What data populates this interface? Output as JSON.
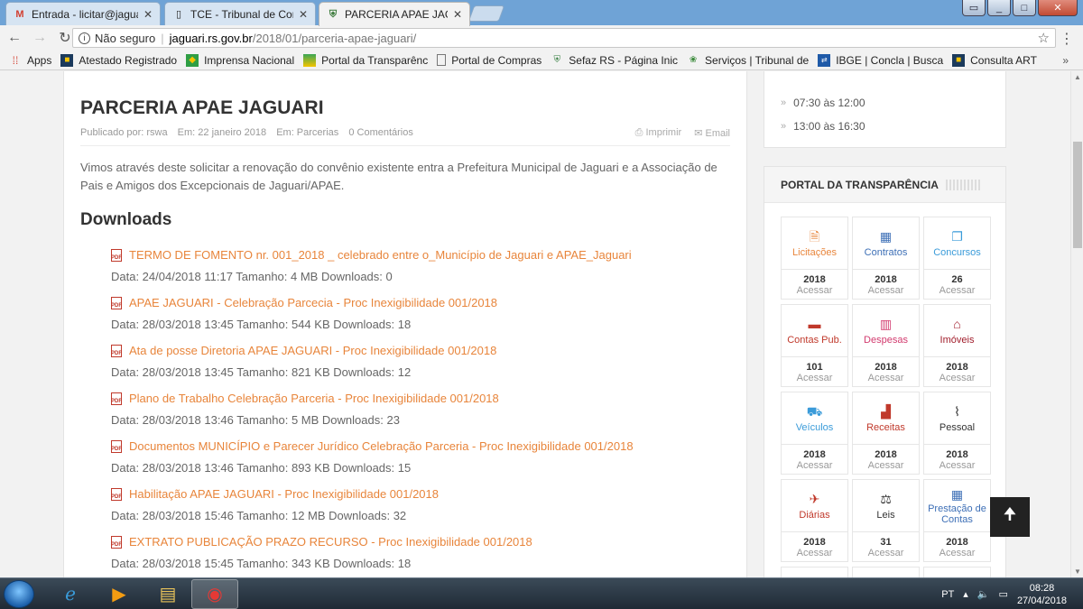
{
  "browser": {
    "tabs": [
      {
        "title": "Entrada - licitar@jaguari",
        "favicon": "gmail-icon",
        "active": false
      },
      {
        "title": "TCE - Tribunal de Contas",
        "favicon": "document-icon",
        "active": false
      },
      {
        "title": "PARCERIA APAE JAGUARI",
        "favicon": "jaguari-crest-icon",
        "active": true
      }
    ],
    "url_security": "Não seguro",
    "url_host": "jaguari.rs.gov.br",
    "url_path": "/2018/01/parceria-apae-jaguari/",
    "bookmarks": [
      {
        "label": "Apps",
        "icon": "apps-grid-icon"
      },
      {
        "label": "Atestado Registrado",
        "icon": "crea-icon"
      },
      {
        "label": "Imprensa Nacional",
        "icon": "brazil-flag-icon"
      },
      {
        "label": "Portal da Transparênc",
        "icon": "transparency-icon"
      },
      {
        "label": "Portal de Compras",
        "icon": "page-icon"
      },
      {
        "label": "Sefaz RS - Página Inic",
        "icon": "rs-crest-icon"
      },
      {
        "label": "Serviços | Tribunal de",
        "icon": "tce-icon"
      },
      {
        "label": "IBGE | Concla | Busca",
        "icon": "ibge-icon"
      },
      {
        "label": "Consulta ART",
        "icon": "crea-icon"
      }
    ],
    "bookmarks_more": "»"
  },
  "article": {
    "title": "PARCERIA APAE JAGUARI",
    "meta_author": "Publicado por: rswa",
    "meta_date": "Em: 22 janeiro 2018",
    "meta_category": "Em: Parcerias",
    "meta_comments": "0 Comentários",
    "print_label": "Imprimir",
    "email_label": "Email",
    "intro": "Vimos através deste solicitar a renovação do convênio existente entra a Prefeitura Municipal de Jaguari e a Associação de Pais e Amigos dos Excepcionais de Jaguari/APAE.",
    "downloads_title": "Downloads",
    "downloads": [
      {
        "name": "TERMO DE FOMENTO nr. 001_2018 _ celebrado entre o_Município de Jaguari e APAE_Jaguari",
        "info": "Data: 24/04/2018 11:17 Tamanho: 4 MB Downloads: 0"
      },
      {
        "name": "APAE JAGUARI - Celebração Parcecia - Proc Inexigibilidade 001/2018",
        "info": "Data: 28/03/2018 13:45 Tamanho: 544 KB Downloads: 18"
      },
      {
        "name": "Ata de posse Diretoria APAE JAGUARI - Proc Inexigibilidade 001/2018",
        "info": "Data: 28/03/2018 13:45 Tamanho: 821 KB Downloads: 12"
      },
      {
        "name": "Plano de Trabalho Celebração Parceria - Proc Inexigibilidade 001/2018",
        "info": "Data: 28/03/2018 13:46 Tamanho: 5 MB Downloads: 23"
      },
      {
        "name": "Documentos MUNICÍPIO e Parecer Jurídico Celebração Parceria - Proc Inexigibilidade 001/2018",
        "info": "Data: 28/03/2018 13:46 Tamanho: 893 KB Downloads: 15"
      },
      {
        "name": "Habilitação APAE JAGUARI - Proc Inexigibilidade 001/2018",
        "info": "Data: 28/03/2018 15:46 Tamanho: 12 MB Downloads: 32"
      },
      {
        "name": "EXTRATO PUBLICAÇÃO PRAZO RECURSO - Proc Inexigibilidade 001/2018",
        "info": "Data: 28/03/2018 15:45 Tamanho: 343 KB Downloads: 18"
      }
    ]
  },
  "sidebar": {
    "hours": [
      "07:30 às 12:00",
      "13:00 às 16:30"
    ],
    "portal_title": "PORTAL DA TRANSPARÊNCIA",
    "tiles": [
      {
        "label": "Licitações",
        "value": "2018",
        "action": "Acessar",
        "icon": "document-icon",
        "color": "#e8853b"
      },
      {
        "label": "Contratos",
        "value": "2018",
        "action": "Acessar",
        "icon": "calendar-icon",
        "color": "#3d6fb6"
      },
      {
        "label": "Concursos",
        "value": "26",
        "action": "Acessar",
        "icon": "copy-icon",
        "color": "#3a9bd9"
      },
      {
        "label": "Contas Pub.",
        "value": "101",
        "action": "Acessar",
        "icon": "wallet-icon",
        "color": "#c0392b"
      },
      {
        "label": "Despesas",
        "value": "2018",
        "action": "Acessar",
        "icon": "bar-chart-icon",
        "color": "#d23a6e"
      },
      {
        "label": "Imóveis",
        "value": "2018",
        "action": "Acessar",
        "icon": "building-icon",
        "color": "#a11d2b"
      },
      {
        "label": "Veículos",
        "value": "2018",
        "action": "Acessar",
        "icon": "car-icon",
        "color": "#3a9bd9"
      },
      {
        "label": "Receitas",
        "value": "2018",
        "action": "Acessar",
        "icon": "chart-icon",
        "color": "#c0392b"
      },
      {
        "label": "Pessoal",
        "value": "2018",
        "action": "Acessar",
        "icon": "paperclip-icon",
        "color": "#333333"
      },
      {
        "label": "Diárias",
        "value": "2018",
        "action": "Acessar",
        "icon": "airplane-icon",
        "color": "#c0392b"
      },
      {
        "label": "Leis",
        "value": "31",
        "action": "Acessar",
        "icon": "gavel-icon",
        "color": "#333333"
      },
      {
        "label": "Prestação de Contas",
        "value": "2018",
        "action": "Acessar",
        "icon": "calendar-icon",
        "color": "#3d6fb6"
      }
    ]
  },
  "taskbar": {
    "language": "PT",
    "time": "08:28",
    "date": "27/04/2018"
  }
}
